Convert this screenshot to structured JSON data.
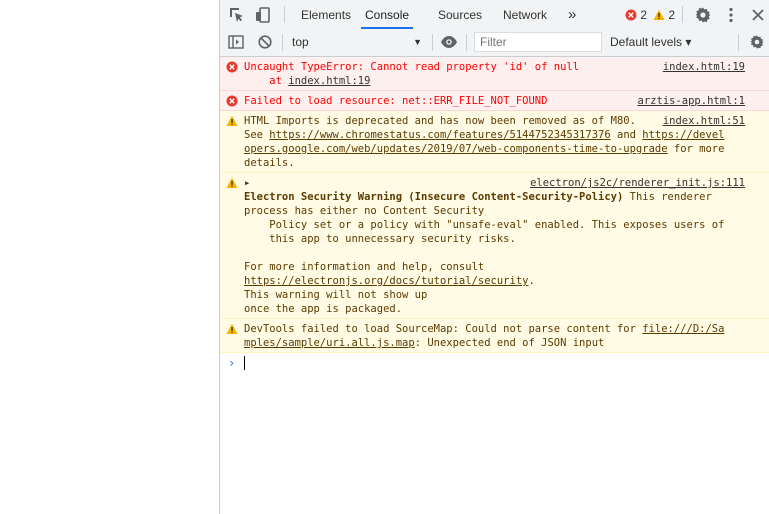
{
  "tabbar": {
    "tabs": [
      {
        "label": "Elements"
      },
      {
        "label": "Console"
      },
      {
        "label": "Sources"
      },
      {
        "label": "Network"
      }
    ],
    "more_label": "»",
    "error_count": "2",
    "warning_count": "2"
  },
  "toolbar": {
    "context": "top",
    "filter_placeholder": "Filter",
    "levels_label": "Default levels ▾"
  },
  "messages": [
    {
      "type": "error",
      "lines": [
        "Uncaught TypeError: Cannot read property 'id' of null"
      ],
      "at_prefix": "    at ",
      "at_link": "index.html:19",
      "source": "index.html:19"
    },
    {
      "type": "error",
      "lines": [
        "Failed to load resource: net::ERR_FILE_NOT_FOUND"
      ],
      "source": "arztis-app.html:1"
    },
    {
      "type": "warning",
      "text1": "HTML Imports is deprecated and has now been removed as of M80.",
      "source": "index.html:51",
      "text2": "See ",
      "link1": "https://www.chromestatus.com/features/5144752345317376",
      "text3": " and ",
      "link2a": "https://devel",
      "link2b": "opers.google.com/web/updates/2019/07/web-components-time-to-upgrade",
      "text4": " for more",
      "text5": "details."
    },
    {
      "type": "warning",
      "expander": "▸",
      "source": "electron/js2c/renderer_init.js:111",
      "bold_title": "Electron Security Warning (Insecure Content-Security-Policy)",
      "title_rest": " This renderer",
      "l2": "process has either no Content Security",
      "l3": "    Policy set or a policy with \"unsafe-eval\" enabled. This exposes users of",
      "l4": "    this app to unnecessary security risks.",
      "l5": "For more information and help, consult",
      "link": "https://electronjs.org/docs/tutorial/security",
      "link_after": ".",
      "l7": "This warning will not show up",
      "l8": "once the app is packaged."
    },
    {
      "type": "warning",
      "text1": "DevTools failed to load SourceMap: Could not parse content for ",
      "link_a": "file:///D:/Sa",
      "link_b": "mples/sample/uri.all.js.map",
      "text2": ": Unexpected end of JSON input"
    }
  ],
  "prompt_symbol": "›",
  "colors": {
    "error_bg": "#fff0f0",
    "error_text": "#fe0000",
    "warning_bg": "#fffbe5",
    "warning_text": "#5c3b00",
    "accent": "#1a73e8"
  }
}
